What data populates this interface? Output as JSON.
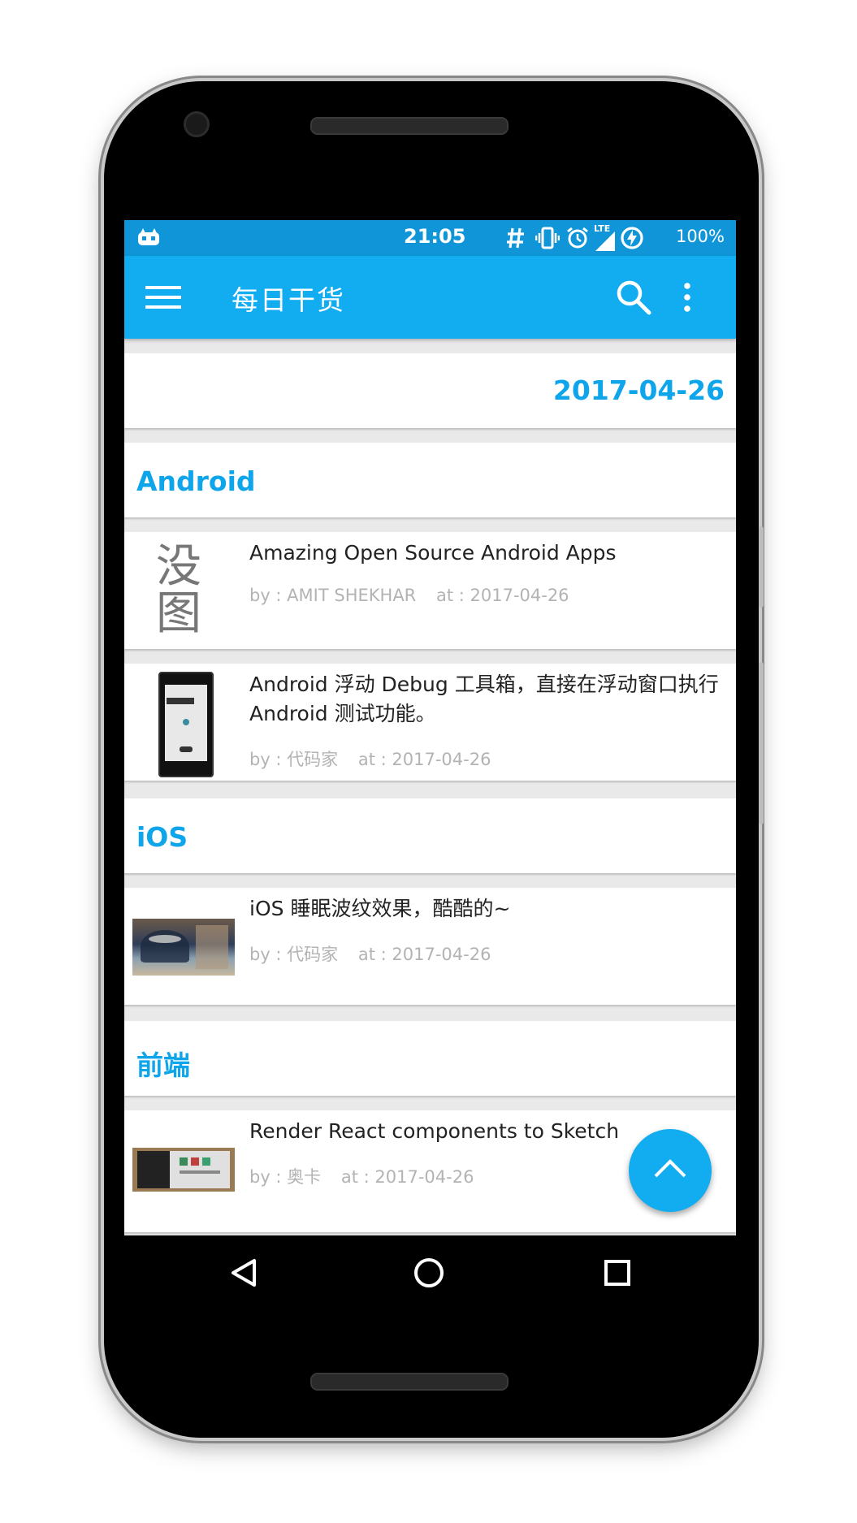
{
  "status_bar": {
    "time": "21:05",
    "battery_pct": "100%",
    "network": "LTE",
    "icons": [
      "notification-icon",
      "hash-icon",
      "vibrate-icon",
      "alarm-icon",
      "signal-icon",
      "battery-charging-icon"
    ]
  },
  "app_bar": {
    "title": "每日干货",
    "icons": [
      "menu-icon",
      "search-icon",
      "more-vert-icon"
    ]
  },
  "date_header": "2017-04-26",
  "sections": [
    {
      "title": "Android",
      "items": [
        {
          "title": "Amazing Open Source Android Apps",
          "by": "by : AMIT SHEKHAR",
          "at": "at : 2017-04-26",
          "thumb_text": "没图"
        },
        {
          "title": "Android 浮动 Debug 工具箱，直接在浮动窗口执行 Android 测试功能。",
          "by": "by : 代码家",
          "at": "at : 2017-04-26"
        }
      ]
    },
    {
      "title": "iOS",
      "items": [
        {
          "title": "iOS 睡眠波纹效果，酷酷的~",
          "by": "by : 代码家",
          "at": "at : 2017-04-26"
        }
      ]
    },
    {
      "title": "前端",
      "items": [
        {
          "title": "Render React components to Sketch",
          "by": "by : 奥卡",
          "at": "at : 2017-04-26"
        }
      ]
    }
  ],
  "colors": {
    "primary": "#12acf0",
    "status_bar": "#0f95d8",
    "accent_text": "#0ea5ea",
    "meta_text": "#b3b3b3"
  },
  "fab_icon": "chevron-up-icon",
  "nav_icons": [
    "back-icon",
    "home-icon",
    "recents-icon"
  ]
}
